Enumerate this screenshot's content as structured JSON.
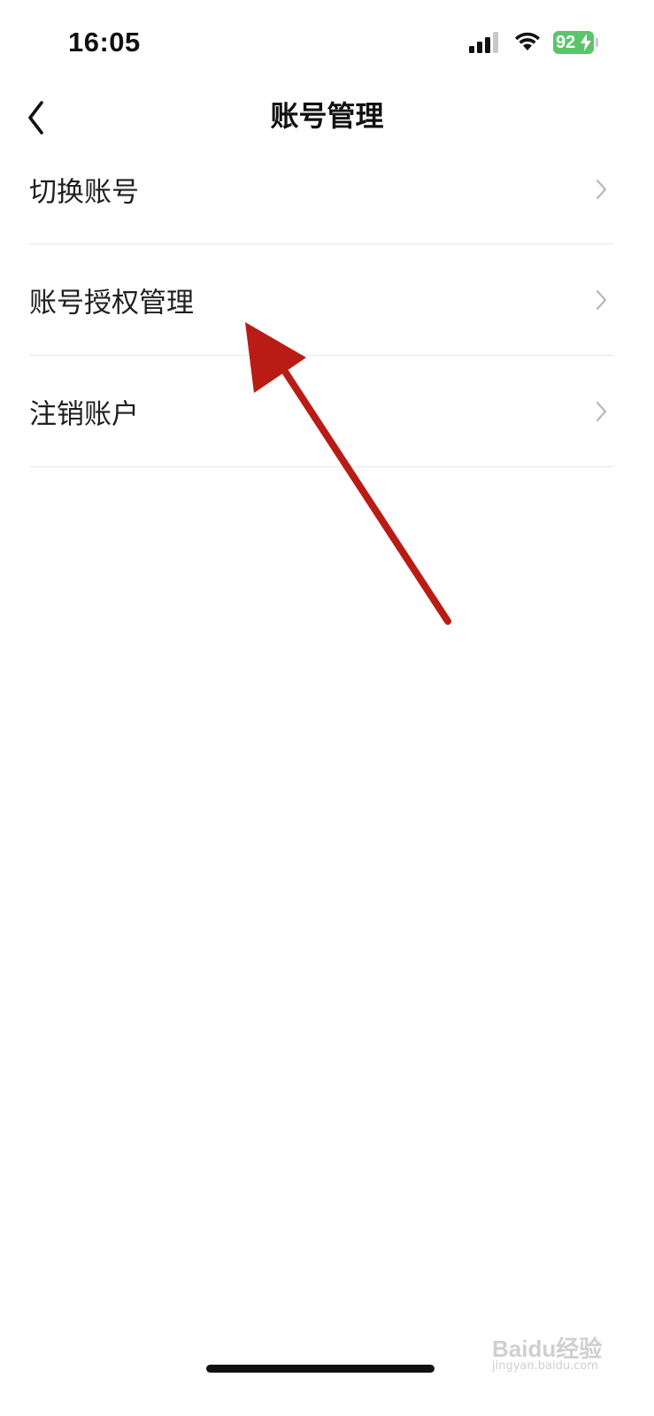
{
  "status_bar": {
    "time": "16:05",
    "battery_level": "92",
    "signal_icon": "cellular-signal-icon",
    "wifi_icon": "wifi-icon",
    "battery_icon": "battery-charging-icon",
    "battery_color": "#5cc46a"
  },
  "nav": {
    "title": "账号管理",
    "back_icon": "chevron-left-icon"
  },
  "list": {
    "items": [
      {
        "label": "切换账号",
        "icon": "chevron-right-icon"
      },
      {
        "label": "账号授权管理",
        "icon": "chevron-right-icon"
      },
      {
        "label": "注销账户",
        "icon": "chevron-right-icon"
      }
    ]
  },
  "annotation": {
    "arrow_color": "#b91c14"
  },
  "watermark": {
    "brand": "Baidu经验",
    "url": "jingyan.baidu.com"
  }
}
